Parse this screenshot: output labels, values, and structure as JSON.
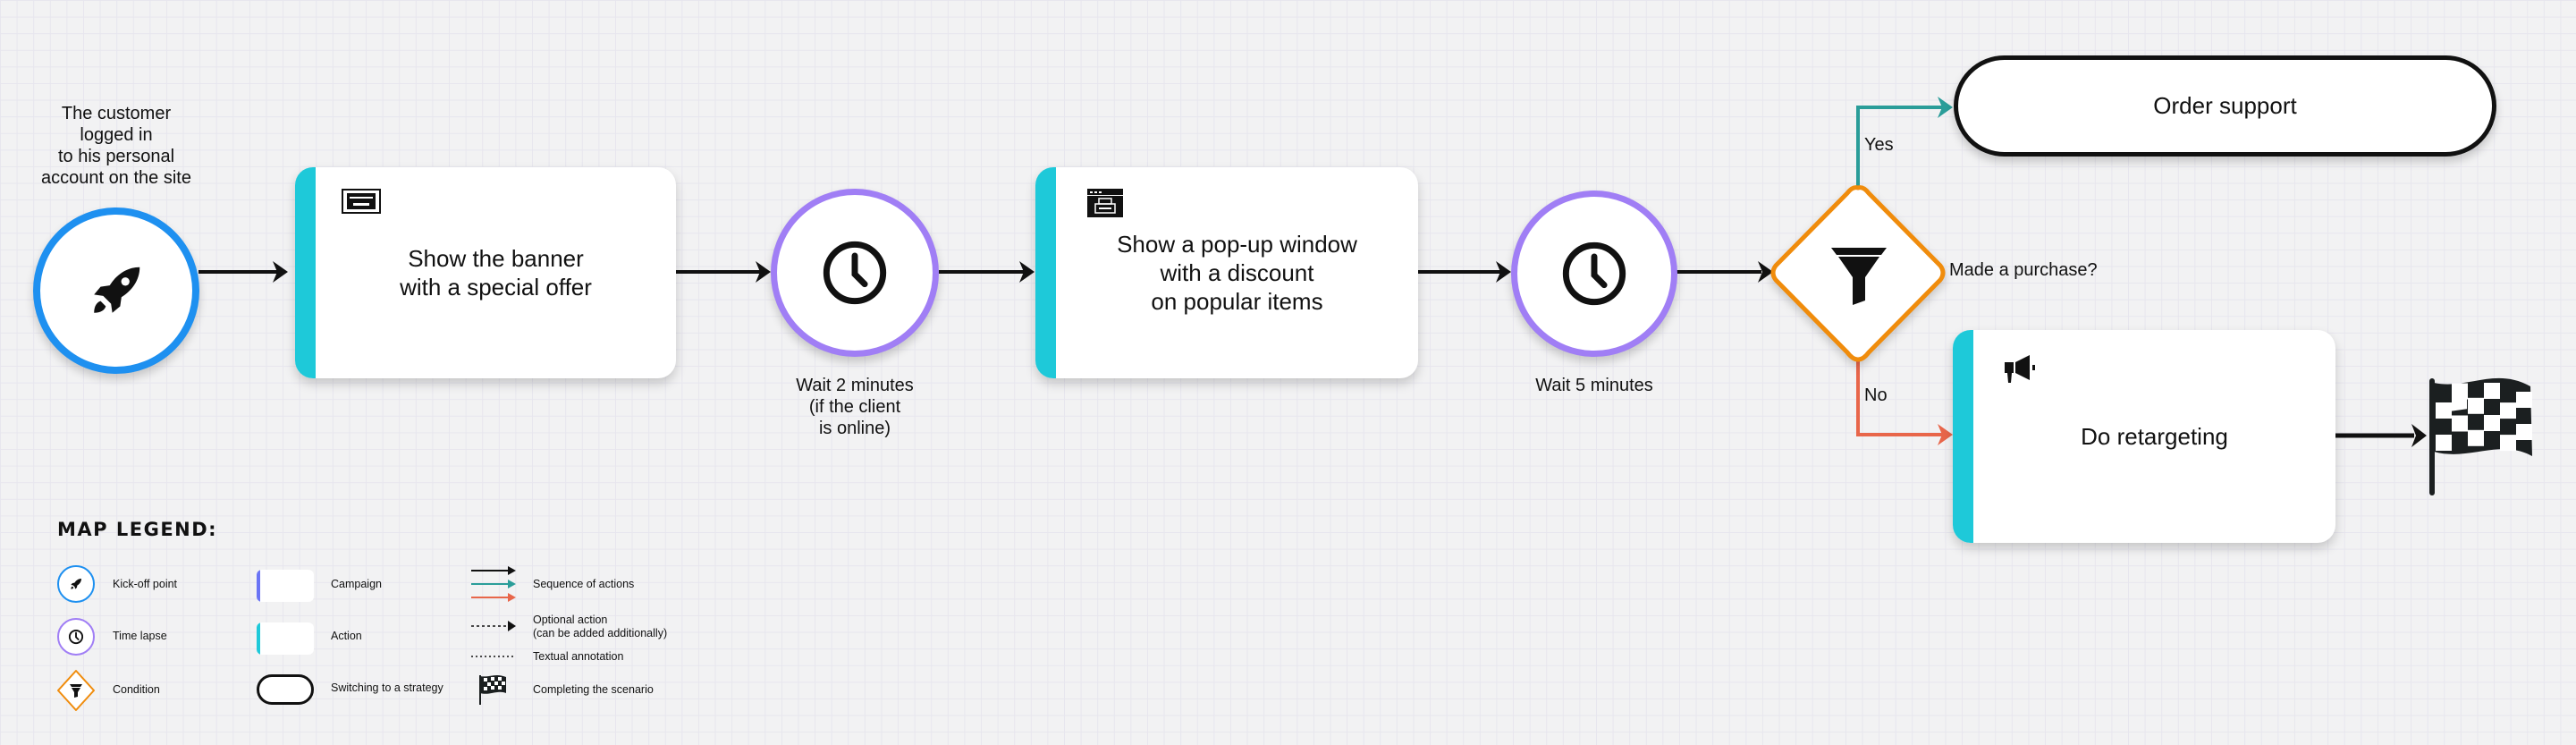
{
  "colors": {
    "kickoff": "#1e90f0",
    "time_lapse": "#a07ef5",
    "condition": "#f08c0c",
    "action_accent": "#1ec9d9",
    "campaign_accent": "#6a74f5",
    "arrow_default": "#111111",
    "arrow_yes": "#2a9d99",
    "arrow_no": "#e8664a"
  },
  "flow": {
    "kickoff": {
      "icon": "rocket-icon",
      "label": "The customer\nlogged in\nto his personal\naccount on the site"
    },
    "action_banner": {
      "icon": "banner-icon",
      "text": "Show the banner\nwith a special offer"
    },
    "wait_1": {
      "icon": "clock-icon",
      "label": "Wait 2 minutes\n(if the client\nis online)"
    },
    "action_popup": {
      "icon": "popup-window-icon",
      "text": "Show a pop-up window\nwith a discount\non popular items"
    },
    "wait_2": {
      "icon": "clock-icon",
      "label": "Wait 5 minutes"
    },
    "condition": {
      "icon": "funnel-icon",
      "label": "Made a purchase?",
      "yes_label": "Yes",
      "no_label": "No"
    },
    "strategy": {
      "text": "Order support"
    },
    "action_retarget": {
      "icon": "megaphone-icon",
      "text": "Do retargeting"
    },
    "finish": {
      "icon": "checkered-flag-icon"
    }
  },
  "legend": {
    "title": "MAP LEGEND:",
    "items": [
      {
        "symbol": "kick-off-circle",
        "label": "Kick-off point"
      },
      {
        "symbol": "time-lapse-circle",
        "label": "Time lapse"
      },
      {
        "symbol": "condition-diamond",
        "label": "Condition"
      },
      {
        "symbol": "campaign-card",
        "label": "Campaign"
      },
      {
        "symbol": "action-card",
        "label": "Action"
      },
      {
        "symbol": "strategy-pill",
        "label": "Switching to a strategy"
      },
      {
        "symbol": "solid-arrows",
        "label": "Sequence of actions"
      },
      {
        "symbol": "dotted-arrow",
        "label": "Optional action\n(can be added additionally)"
      },
      {
        "symbol": "dotted-line",
        "label": "Textual annotation"
      },
      {
        "symbol": "checkered-flag",
        "label": "Completing the scenario"
      }
    ]
  }
}
